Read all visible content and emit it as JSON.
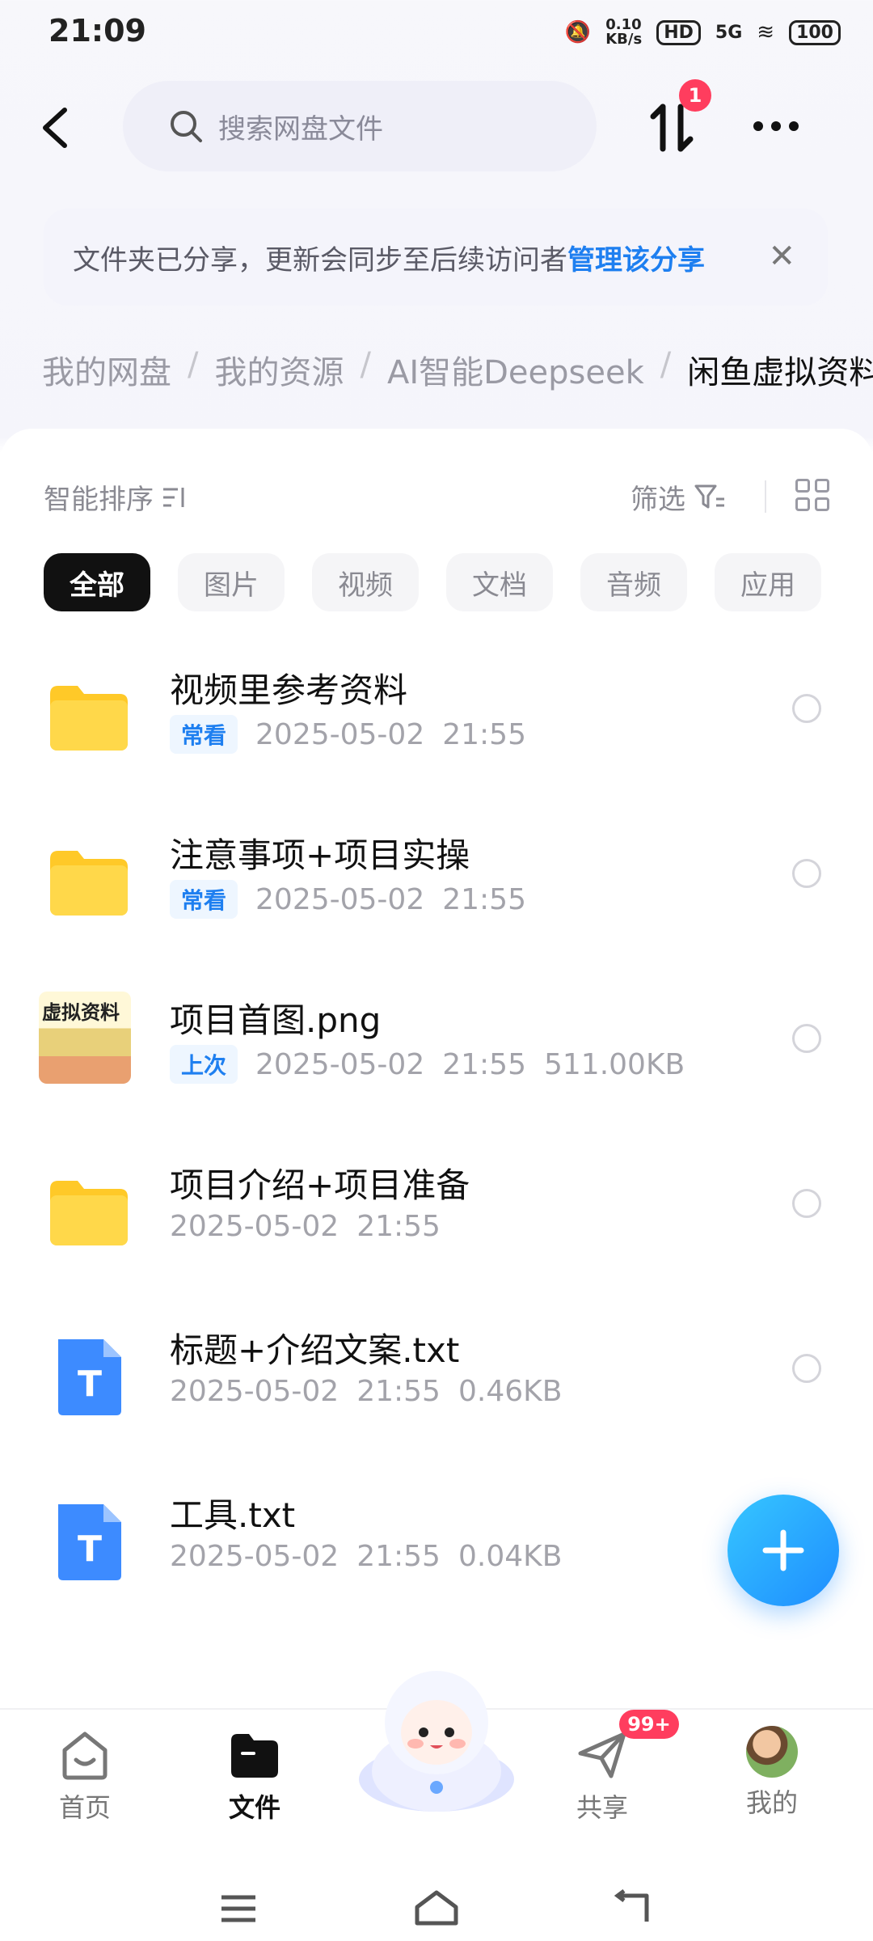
{
  "status_bar": {
    "time": "21:09",
    "net_speed_top": "0.10",
    "net_speed_unit": "KB/s",
    "hd": "HD",
    "signal": "5G",
    "battery": "100"
  },
  "header": {
    "search_placeholder": "搜索网盘文件",
    "transfer_badge": "1"
  },
  "banner": {
    "text": "文件夹已分享，更新会同步至后续访问者",
    "link": "管理该分享"
  },
  "breadcrumb": [
    "我的网盘",
    "我的资源",
    "AI智能Deepseek",
    "闲鱼虚拟资料"
  ],
  "toolbar": {
    "sort_label": "智能排序",
    "filter_label": "筛选"
  },
  "tabs": [
    "全部",
    "图片",
    "视频",
    "文档",
    "音频",
    "应用"
  ],
  "files": [
    {
      "name": "视频里参考资料",
      "tag": "常看",
      "date": "2025-05-02",
      "time": "21:55",
      "size": "",
      "type": "folder"
    },
    {
      "name": "注意事项+项目实操",
      "tag": "常看",
      "date": "2025-05-02",
      "time": "21:55",
      "size": "",
      "type": "folder"
    },
    {
      "name": "项目首图.png",
      "tag": "上次",
      "date": "2025-05-02",
      "time": "21:55",
      "size": "511.00KB",
      "type": "image",
      "thumb_text": "虚拟资料"
    },
    {
      "name": "项目介绍+项目准备",
      "tag": "",
      "date": "2025-05-02",
      "time": "21:55",
      "size": "",
      "type": "folder"
    },
    {
      "name": "标题+介绍文案.txt",
      "tag": "",
      "date": "2025-05-02",
      "time": "21:55",
      "size": "0.46KB",
      "type": "txt"
    },
    {
      "name": "工具.txt",
      "tag": "",
      "date": "2025-05-02",
      "time": "21:55",
      "size": "0.04KB",
      "type": "txt"
    }
  ],
  "bottom_nav": {
    "home": "首页",
    "files": "文件",
    "share": "共享",
    "share_badge": "99+",
    "mine": "我的"
  },
  "colors": {
    "accent": "#1e7ff0",
    "badge": "#ff3d5e",
    "folder": "#ffc928"
  }
}
